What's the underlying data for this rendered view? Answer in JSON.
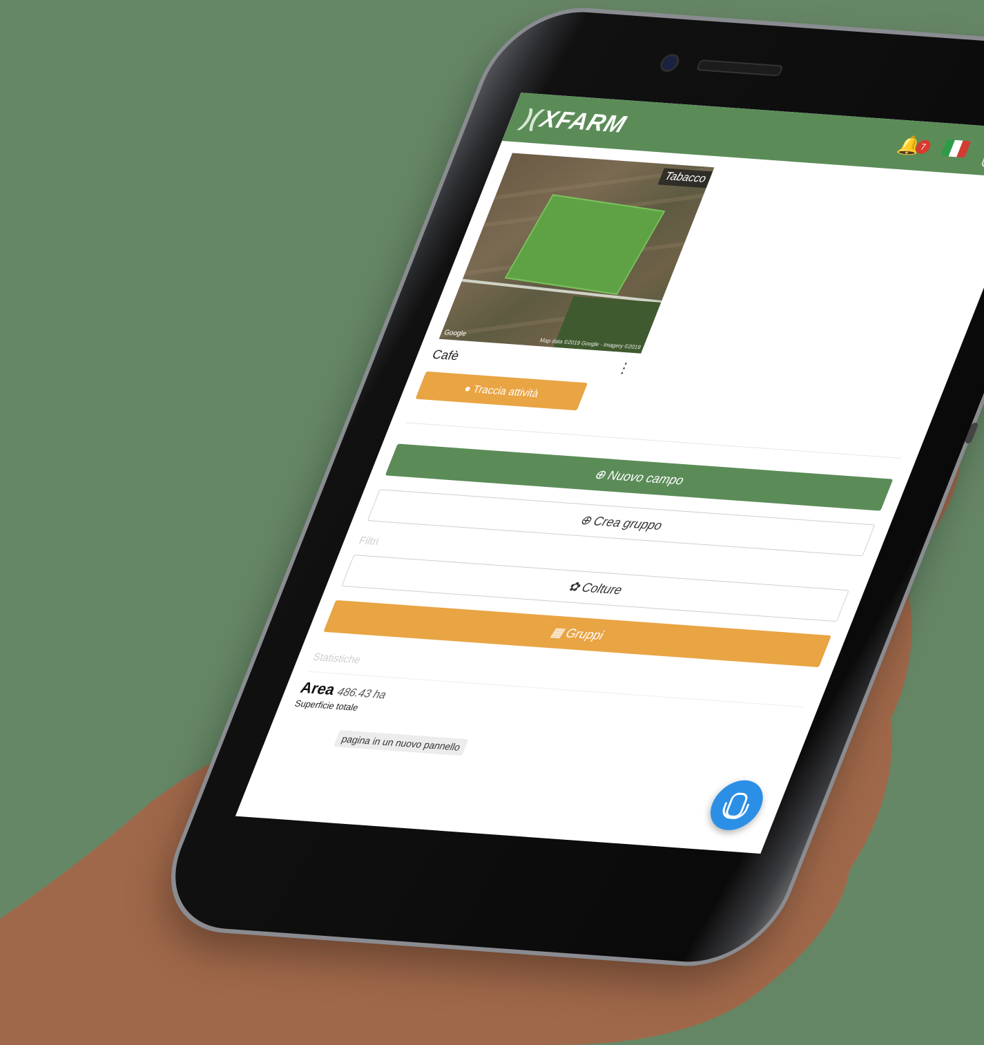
{
  "header": {
    "logo": "XFARM",
    "logo_mark": ")(",
    "notification_count": "7",
    "language_flag_colors": [
      "#2e9b48",
      "#ffffff",
      "#d43b32"
    ]
  },
  "field_card": {
    "crop_tag": "Tabacco",
    "map_attribution_left": "Google",
    "map_attribution_right": "Map data ©2019 Google · Imagery ©2019",
    "name": "Cafè",
    "track_activity_label": "Traccia attività"
  },
  "actions": {
    "new_field_label": "Nuovo campo",
    "create_group_label": "Crea gruppo"
  },
  "filters": {
    "section_label": "Filtri",
    "crops_label": "Colture",
    "groups_label": "Gruppi"
  },
  "stats": {
    "section_label": "Statistiche",
    "area_title": "Area",
    "area_value": "486.43 ha",
    "area_subtitle": "Superficie totale",
    "tooltip": "pagina in un nuovo pannello"
  },
  "colors": {
    "brand_green": "#5b8c58",
    "accent_orange": "#e9a443",
    "fab_blue": "#2b8fe6",
    "background": "#668766"
  },
  "icons": [
    "bell-icon",
    "menu-icon",
    "plus-circle-icon",
    "leaf-icon",
    "grid-icon",
    "microphone-icon",
    "pin-icon"
  ]
}
